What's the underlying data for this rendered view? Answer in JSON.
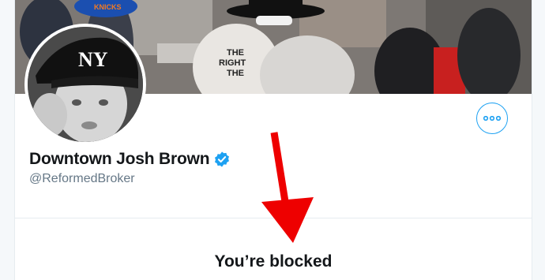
{
  "profile": {
    "display_name": "Downtown Josh Brown",
    "handle": "@ReformedBroker",
    "verified": true,
    "avatar_cap_text": "NY",
    "banner_caption_lines": [
      "THE",
      "RIGHT",
      "THE"
    ],
    "banner_cap_text": "KNICKS"
  },
  "actions": {
    "more_icon": "more-horizontal-icon"
  },
  "status": {
    "blocked_text": "You’re blocked"
  },
  "annotation": {
    "arrow_icon": "red-arrow-pointer"
  },
  "colors": {
    "accent": "#1da1f2",
    "arrow": "#ee0000",
    "text": "#14171a",
    "muted": "#657786"
  }
}
